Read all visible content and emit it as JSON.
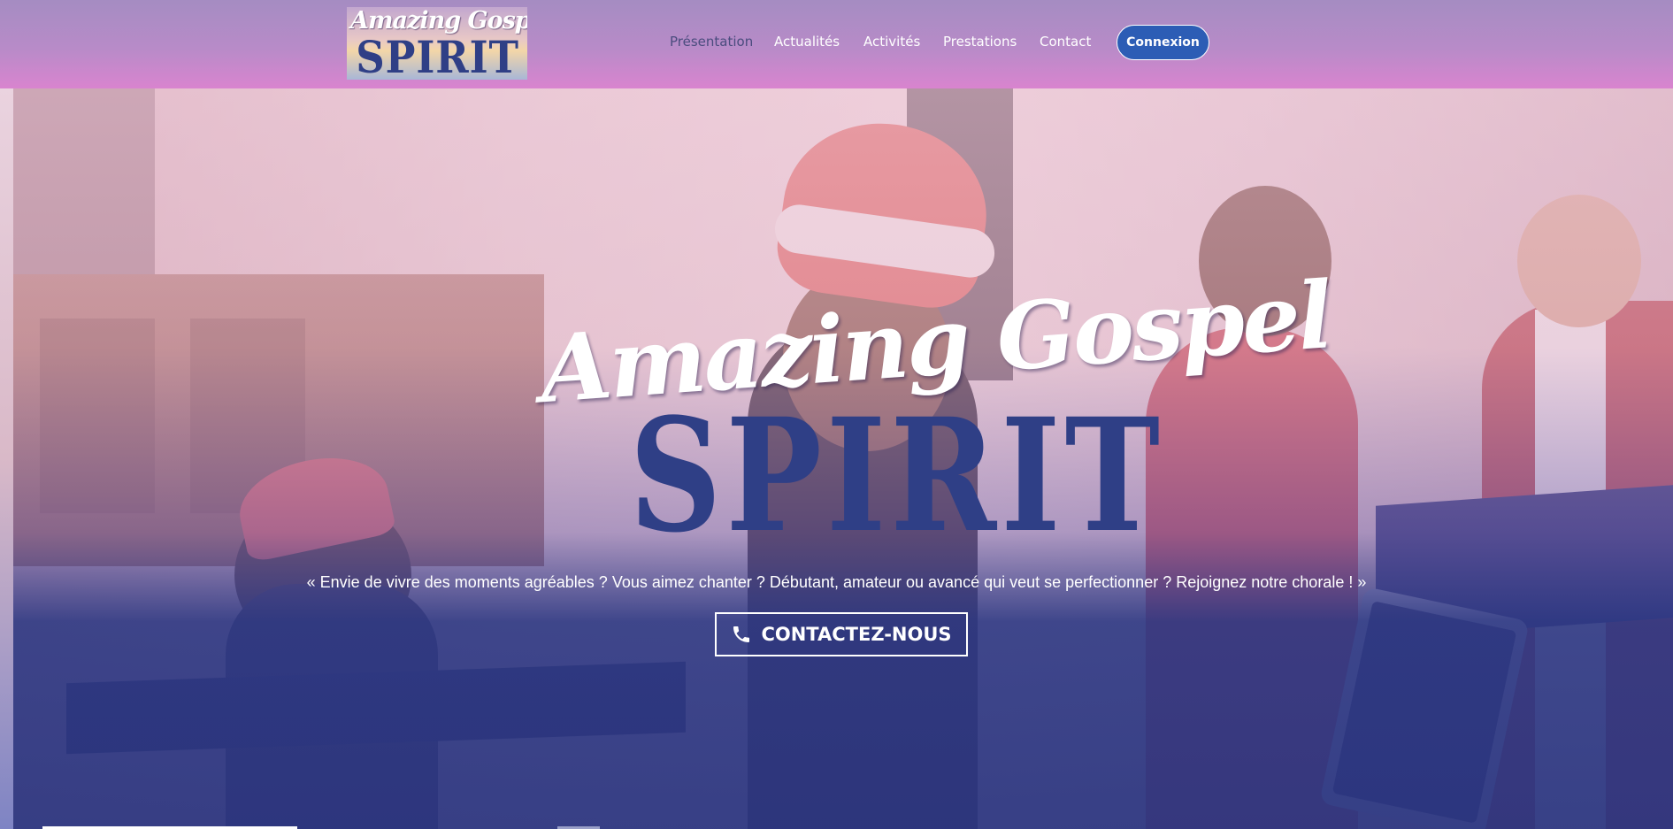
{
  "header": {
    "logo": {
      "script_text": "Amazing Gospel",
      "block_text": "SPIRIT"
    },
    "nav": [
      {
        "label": "Présentation",
        "active": true
      },
      {
        "label": "Actualités",
        "active": false
      },
      {
        "label": "Activités",
        "active": false
      },
      {
        "label": "Prestations",
        "active": false
      },
      {
        "label": "Contact",
        "active": false
      }
    ],
    "login_label": "Connexion"
  },
  "hero": {
    "logo": {
      "script_text": "Amazing Gospel",
      "block_text": "SPIRIT"
    },
    "tagline": "« Envie de vivre des moments agréables ? Vous aimez chanter ? Débutant, amateur ou avancé qui veut se perfectionner ? Rejoignez notre chorale ! »",
    "cta_label": "CONTACTEZ-NOUS",
    "cta_icon": "phone-icon",
    "background_image": "choir singers in Santa hats performing in a church"
  },
  "colors": {
    "header_top": "#a58cc2",
    "header_bottom": "#d984cf",
    "nav_active": "#4a4c7e",
    "login_button": "#2c5db5",
    "logo_block": "#2f3f86",
    "hero_overlay_bottom": "#2c3680"
  }
}
